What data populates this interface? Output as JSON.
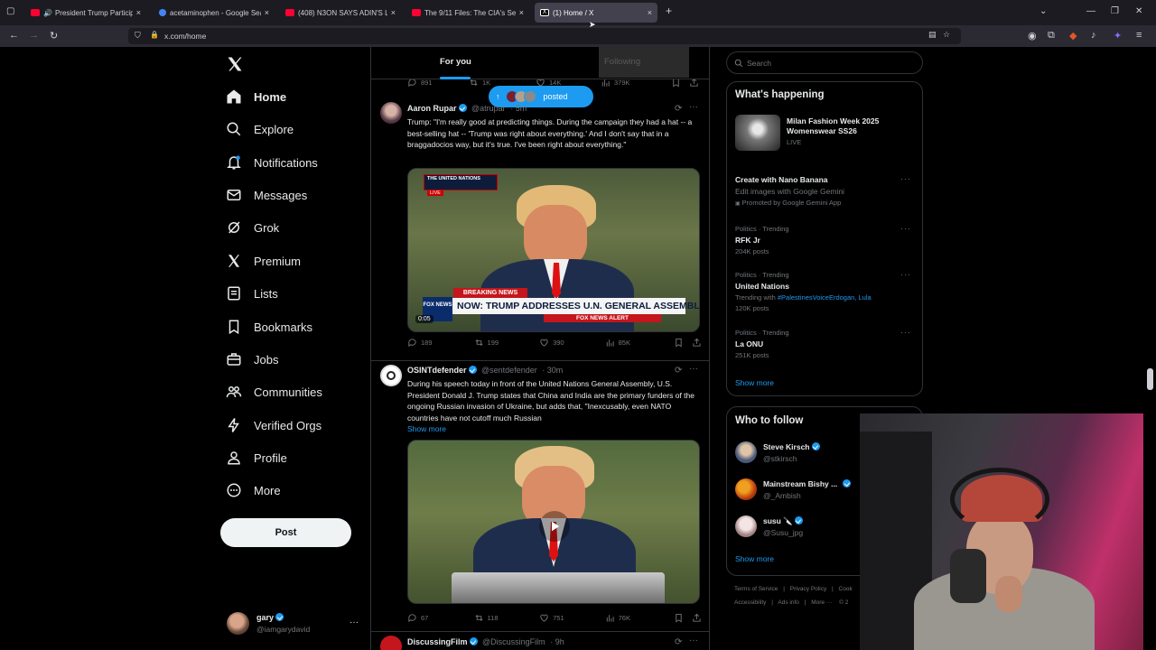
{
  "browser": {
    "tabs": [
      {
        "title": "President Trump Participate",
        "favicon_color": "#ff0033",
        "muted": true
      },
      {
        "title": "acetaminophen - Google Searc",
        "favicon_color": "#4285f4"
      },
      {
        "title": "(408) N3ON SAYS ADIN'S LAZY",
        "favicon_color": "#ff0033"
      },
      {
        "title": "The 9/11 Files: The CIA's Secret",
        "favicon_color": "#ff0033"
      },
      {
        "title": "(1) Home / X",
        "favicon_color": "#ffffff",
        "active": true
      }
    ],
    "new_tab_label": "+",
    "url": "x.com/home"
  },
  "nav": {
    "items": [
      {
        "label": "Home",
        "icon": "home-icon"
      },
      {
        "label": "Explore",
        "icon": "search-icon"
      },
      {
        "label": "Notifications",
        "icon": "bell-icon"
      },
      {
        "label": "Messages",
        "icon": "mail-icon"
      },
      {
        "label": "Grok",
        "icon": "grok-icon"
      },
      {
        "label": "Premium",
        "icon": "x-logo-icon"
      },
      {
        "label": "Lists",
        "icon": "list-icon"
      },
      {
        "label": "Bookmarks",
        "icon": "bookmark-icon"
      },
      {
        "label": "Jobs",
        "icon": "briefcase-icon"
      },
      {
        "label": "Communities",
        "icon": "people-icon"
      },
      {
        "label": "Verified Orgs",
        "icon": "lightning-icon"
      },
      {
        "label": "Profile",
        "icon": "person-icon"
      },
      {
        "label": "More",
        "icon": "more-circle-icon"
      }
    ],
    "post_label": "Post",
    "account": {
      "name": "gary",
      "handle": "@iamgarydavid"
    }
  },
  "feed": {
    "tabs": {
      "for_you": "For you",
      "following": "Following"
    },
    "posted_pill": "posted",
    "prev_actions": {
      "replies": "891",
      "reposts": "1K",
      "likes": "14K",
      "views": "379K"
    },
    "tweets": [
      {
        "name": "Aaron Rupar",
        "handle": "@atrupar",
        "time": "· 5m",
        "text": "Trump: \"I'm really good at predicting things. During the campaign they had a hat -- a best-selling hat -- 'Trump was right about everything.' And I don't say that in a braggadocios way, but it's true. I've been right about everything.\"",
        "media": {
          "banner_top": "THE UNITED NATIONS",
          "banner_live": "LIVE",
          "breaking": "BREAKING NEWS",
          "headline": "NOW: TRUMP ADDRESSES U.N. GENERAL ASSEMBLY",
          "alert": "FOX NEWS ALERT",
          "network": "FOX NEWS",
          "duration": "0:05"
        },
        "actions": {
          "replies": "189",
          "reposts": "199",
          "likes": "390",
          "views": "85K"
        }
      },
      {
        "name": "OSINTdefender",
        "handle": "@sentdefender",
        "time": "· 30m",
        "text": "During his speech today in front of the United Nations General Assembly, U.S. President Donald J. Trump states that China and India are the primary funders of the ongoing Russian invasion of Ukraine, but adds that, \"Inexcusably, even NATO countries have not cutoff much Russian",
        "show_more": "Show more",
        "actions": {
          "replies": "67",
          "reposts": "118",
          "likes": "751",
          "views": "76K"
        }
      },
      {
        "name": "DiscussingFilm",
        "handle": "@DiscussingFilm",
        "time": "· 9h"
      }
    ]
  },
  "right": {
    "search_placeholder": "Search",
    "happening": {
      "title": "What's happening",
      "featured": {
        "title": "Milan Fashion Week 2025 Womenswear SS26",
        "status": "LIVE"
      },
      "promo": {
        "title": "Create with Nano Banana",
        "subtitle": "Edit images with Google Gemini",
        "promoted": "Promoted by Google Gemini App"
      },
      "trends": [
        {
          "context": "Politics · Trending",
          "name": "RFK Jr",
          "posts": "204K posts"
        },
        {
          "context": "Politics · Trending",
          "name": "United Nations",
          "with_label": "Trending with",
          "with": "#PalestinesVoiceErdogan, Lula",
          "posts": "120K posts"
        },
        {
          "context": "Politics · Trending",
          "name": "La ONU",
          "posts": "251K posts"
        }
      ],
      "show_more": "Show more"
    },
    "who_to_follow": {
      "title": "Who to follow",
      "people": [
        {
          "name": "Steve Kirsch",
          "handle": "@stkirsch"
        },
        {
          "name": "Mainstream Bishy ...",
          "handle": "@_Ambish"
        },
        {
          "name": "susu 🔪",
          "handle": "@Susu_jpg"
        }
      ],
      "show_more": "Show more"
    },
    "footer": {
      "links": [
        "Terms of Service",
        "Privacy Policy",
        "Cook",
        "Accessibility",
        "Ads info",
        "More ···",
        "© 2"
      ]
    }
  }
}
